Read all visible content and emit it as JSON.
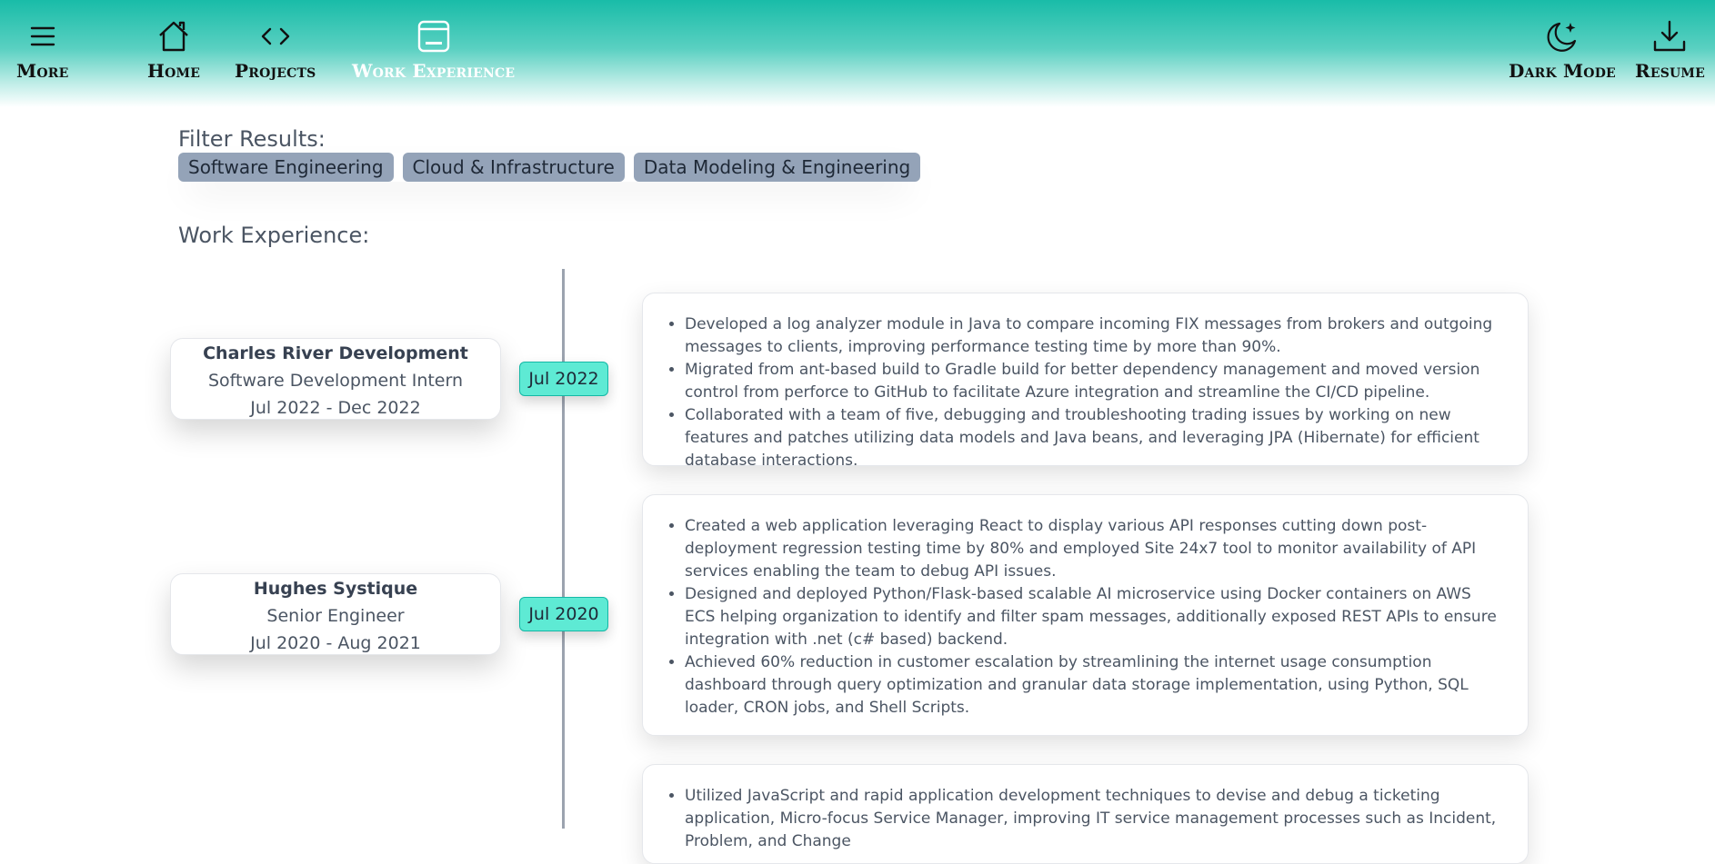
{
  "nav": {
    "left": [
      {
        "id": "more",
        "label": "More",
        "icon": "menu-icon"
      },
      {
        "id": "home",
        "label": "Home",
        "icon": "home-icon"
      },
      {
        "id": "projects",
        "label": "Projects",
        "icon": "code-icon"
      },
      {
        "id": "work",
        "label": "Work Experience",
        "icon": "window-icon",
        "active": true
      }
    ],
    "right": [
      {
        "id": "dark",
        "label": "Dark Mode",
        "icon": "moon-stars-icon"
      },
      {
        "id": "resume",
        "label": "Resume",
        "icon": "download-icon"
      }
    ]
  },
  "filters": {
    "title": "Filter Results:",
    "chips": [
      "Software Engineering",
      "Cloud & Infrastructure",
      "Data Modeling & Engineering"
    ]
  },
  "section_title": "Work Experience:",
  "experiences": [
    {
      "company": "Charles River Development",
      "role": "Software Development Intern",
      "period": "Jul 2022 - Dec 2022",
      "date_pill": "Jul 2022",
      "bullets": [
        "Developed a log analyzer module in Java to compare incoming FIX messages from brokers and outgoing messages to clients, improving performance testing time by more than 90%.",
        "Migrated from ant-based build to Gradle build for better dependency management and moved version control from perforce to GitHub to facilitate Azure integration and streamline the CI/CD pipeline.",
        "Collaborated with a team of five, debugging and troubleshooting trading issues by working on new features and patches utilizing data models and Java beans, and leveraging JPA (Hibernate) for efficient database interactions."
      ]
    },
    {
      "company": "Hughes Systique",
      "role": "Senior Engineer",
      "period": "Jul 2020 - Aug 2021",
      "date_pill": "Jul 2020",
      "bullets": [
        "Created a web application leveraging React to display various API responses cutting down post-deployment regression testing time by 80% and employed Site 24x7 tool to monitor availability of API services enabling the team to debug API issues.",
        "Designed and deployed Python/Flask-based scalable AI microservice using Docker containers on AWS ECS helping organization to identify and filter spam messages, additionally exposed REST APIs to ensure integration with .net (c# based) backend.",
        "Achieved 60% reduction in customer escalation by streamlining the internet usage consumption dashboard through query optimization and granular data storage implementation, using Python, SQL loader, CRON jobs, and Shell Scripts."
      ]
    },
    {
      "bullets": [
        "Utilized JavaScript and rapid application development techniques to devise and debug a ticketing application, Micro-focus Service Manager, improving IT service management processes such as Incident, Problem, and Change"
      ]
    }
  ],
  "colors": {
    "accent_teal": "#19bca8",
    "chip_bg": "#94a3b8",
    "date_pill_bg": "#5eead4"
  }
}
